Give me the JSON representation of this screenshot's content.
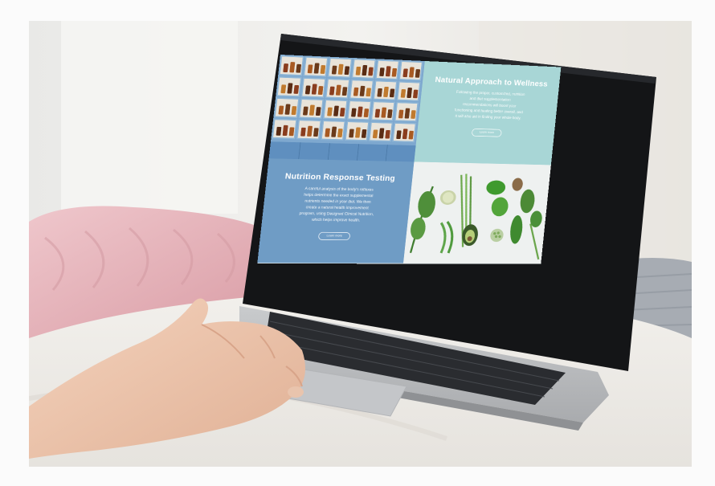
{
  "website": {
    "wellness": {
      "title": "Natural Approach to Wellness",
      "body": "Following the proper, customized, nutrition and diet supplementation recommendations will boost your functioning and healing better overall, and it will also aid in finding your whole body.",
      "button": "Learn more"
    },
    "nutrition": {
      "title": "Nutrition Response Testing",
      "body": "A careful analysis of the body's reflexes helps determine the exact supplemental nutrients needed in your diet. We then create a natural health improvement program, using Designed Clinical Nutrition, which helps improve health.",
      "button": "Learn more"
    }
  },
  "colors": {
    "wellness_tile": "#a8d6d6",
    "nutrition_tile": "#6f9cc5",
    "shelf_frame": "#8fb6d6",
    "laptop_bezel": "#141517",
    "pillow": "#e8b9bf",
    "sheet": "#f3f1ee"
  }
}
